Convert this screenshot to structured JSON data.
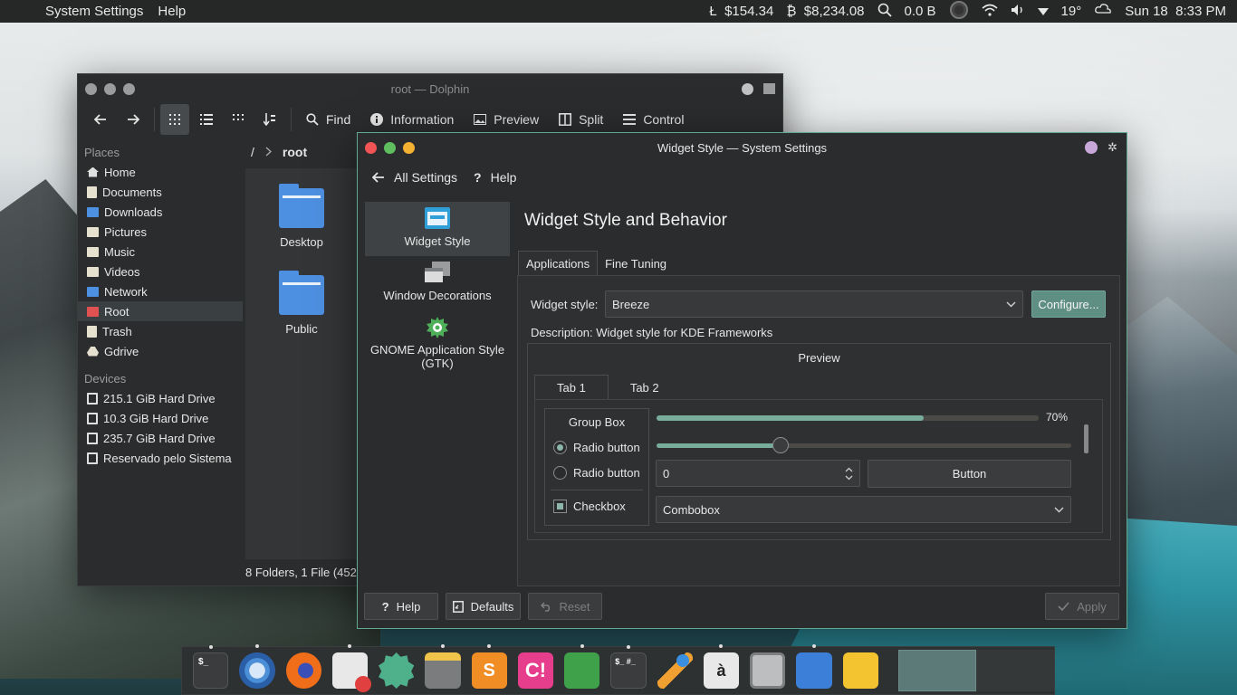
{
  "topbar": {
    "app_name": "System Settings",
    "menu_help": "Help",
    "ltc": "$154.34",
    "btc": "$8,234.08",
    "net": "0.0 B",
    "temp": "19°",
    "date": "Sun 18",
    "time": "8:33 PM"
  },
  "dolphin": {
    "title": "root — Dolphin",
    "toolbar": {
      "find": "Find",
      "information": "Information",
      "preview": "Preview",
      "split": "Split",
      "control": "Control"
    },
    "places_header": "Places",
    "places": [
      {
        "label": "Home",
        "icon": "home-icon"
      },
      {
        "label": "Documents",
        "icon": "documents-icon"
      },
      {
        "label": "Downloads",
        "icon": "downloads-icon"
      },
      {
        "label": "Pictures",
        "icon": "pictures-icon"
      },
      {
        "label": "Music",
        "icon": "music-icon"
      },
      {
        "label": "Videos",
        "icon": "videos-icon"
      },
      {
        "label": "Network",
        "icon": "network-icon"
      },
      {
        "label": "Root",
        "icon": "root-icon"
      },
      {
        "label": "Trash",
        "icon": "trash-icon"
      },
      {
        "label": "Gdrive",
        "icon": "gdrive-icon"
      }
    ],
    "devices_header": "Devices",
    "devices": [
      {
        "label": "215.1 GiB Hard Drive"
      },
      {
        "label": "10.3 GiB Hard Drive"
      },
      {
        "label": "235.7 GiB Hard Drive"
      },
      {
        "label": "Reservado pelo Sistema"
      }
    ],
    "breadcrumb_root": "/",
    "breadcrumb_current": "root",
    "files": [
      {
        "name": "Desktop"
      },
      {
        "name": "Public"
      }
    ],
    "status": "8 Folders, 1 File (452"
  },
  "settings": {
    "title": "Widget Style — System Settings",
    "all_settings": "All Settings",
    "help": "Help",
    "categories": [
      {
        "label": "Widget Style"
      },
      {
        "label": "Window Decorations"
      },
      {
        "label": "GNOME Application Style (GTK)"
      }
    ],
    "page_title": "Widget Style and Behavior",
    "tabs": [
      "Applications",
      "Fine Tuning"
    ],
    "widget_style_label": "Widget style:",
    "widget_style_value": "Breeze",
    "configure": "Configure...",
    "description": "Description: Widget style for KDE Frameworks",
    "preview": {
      "title": "Preview",
      "tabs": [
        "Tab 1",
        "Tab 2"
      ],
      "group_box": "Group Box",
      "radio1": "Radio button",
      "radio2": "Radio button",
      "checkbox": "Checkbox",
      "progress_label": "70%",
      "progress_value": 0.7,
      "slider_value": 0.3,
      "spin_value": "0",
      "button": "Button",
      "combobox": "Combobox"
    },
    "footer": {
      "help": "Help",
      "defaults": "Defaults",
      "reset": "Reset",
      "apply": "Apply"
    }
  },
  "colors": {
    "accent": "#78ad9c",
    "folder": "#4d8fe0",
    "close": "#f05454",
    "minimize": "#5fbf5f",
    "maximize": "#f4b232"
  }
}
